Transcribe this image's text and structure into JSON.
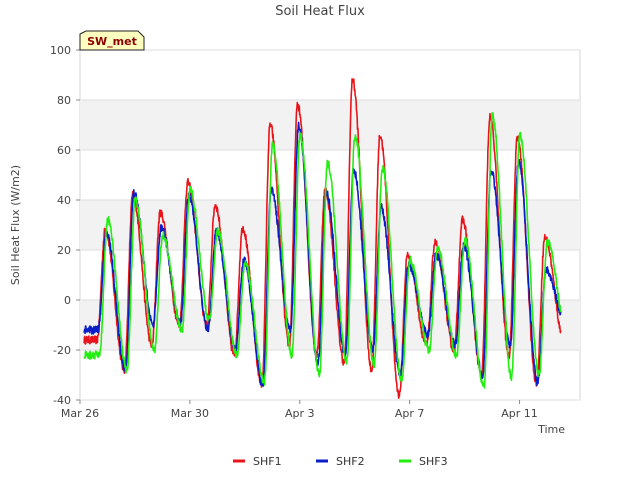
{
  "chart_data": {
    "type": "line",
    "title": "Soil Heat Flux",
    "badge": "SW_met",
    "xlabel": "Time",
    "ylabel": "Soil Heat Flux (W/m2)",
    "x_unit": "days since Mar 26",
    "xlim": [
      0,
      18.2
    ],
    "ylim": [
      -40,
      100
    ],
    "y_ticks": [
      -40,
      -20,
      0,
      20,
      40,
      60,
      80,
      100
    ],
    "x_ticks": [
      {
        "x": 0,
        "label": "Mar 26"
      },
      {
        "x": 4,
        "label": "Mar 30"
      },
      {
        "x": 8,
        "label": "Apr 3"
      },
      {
        "x": 12,
        "label": "Apr 7"
      },
      {
        "x": 16,
        "label": "Apr 11"
      }
    ],
    "grid": true,
    "legend": "bottom-center",
    "series": [
      {
        "name": "SHF1",
        "color": "#e8141a",
        "peaks": [
          28,
          42,
          35,
          47,
          38,
          29,
          70,
          78,
          44,
          88,
          66,
          18,
          23,
          32,
          73,
          65,
          25
        ],
        "troughs": [
          -16,
          -28,
          -18,
          -10,
          -10,
          -22,
          -34,
          -18,
          -22,
          -25,
          -28,
          -38,
          -18,
          -20,
          -30,
          -22,
          -33,
          -16
        ]
      },
      {
        "name": "SHF2",
        "color": "#0a1ec8",
        "peaks": [
          27,
          43,
          29,
          42,
          28,
          16,
          44,
          70,
          43,
          52,
          37,
          14,
          18,
          22,
          52,
          55,
          12
        ],
        "troughs": [
          -12,
          -28,
          -10,
          -9,
          -12,
          -20,
          -34,
          -12,
          -26,
          -22,
          -20,
          -30,
          -14,
          -18,
          -30,
          -18,
          -33,
          -8
        ]
      },
      {
        "name": "SHF3",
        "color": "#22ee10",
        "peaks": [
          32,
          40,
          26,
          44,
          28,
          15,
          62,
          66,
          55,
          66,
          53,
          16,
          21,
          24,
          74,
          66,
          23
        ],
        "troughs": [
          -22,
          -28,
          -20,
          -12,
          -8,
          -22,
          -33,
          -22,
          -30,
          -24,
          -26,
          -32,
          -20,
          -22,
          -35,
          -31,
          -30,
          -12
        ]
      }
    ]
  }
}
